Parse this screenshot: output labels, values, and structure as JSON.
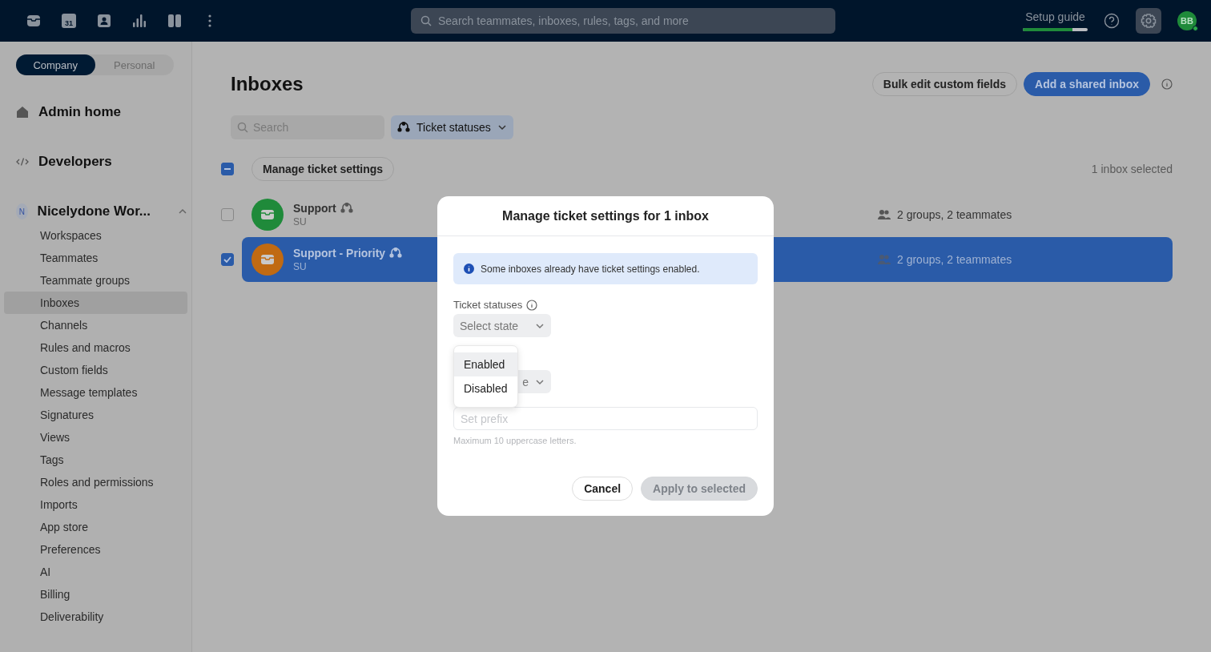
{
  "topbar": {
    "nav_icons": [
      {
        "kind": "inbox"
      },
      {
        "kind": "calendar",
        "text": "31"
      },
      {
        "kind": "contact"
      },
      {
        "kind": "analytics"
      },
      {
        "kind": "panels"
      },
      {
        "kind": "more"
      }
    ],
    "search": {
      "placeholder": "Search teammates, inboxes, rules, tags, and more"
    },
    "setup_guide": {
      "label": "Setup guide",
      "level": 0.77
    },
    "settings_active": true,
    "avatar": {
      "initials": "BB",
      "online": true
    }
  },
  "sidebar": {
    "scope_tabs": [
      {
        "label": "Company",
        "selected": true
      },
      {
        "label": "Personal",
        "selected": false
      }
    ],
    "sections": [
      {
        "kind": "home",
        "label": "Admin home"
      },
      {
        "kind": "code",
        "label": "Developers"
      }
    ],
    "workspace": {
      "badge": "N",
      "label": "Nicelydone Wor...",
      "expanded": true,
      "items": [
        {
          "label": "Workspaces",
          "selected": false
        },
        {
          "label": "Teammates",
          "selected": false
        },
        {
          "label": "Teammate groups",
          "selected": false
        },
        {
          "label": "Inboxes",
          "selected": true
        },
        {
          "label": "Channels",
          "selected": false
        },
        {
          "label": "Rules and macros",
          "selected": false
        },
        {
          "label": "Custom fields",
          "selected": false
        },
        {
          "label": "Message templates",
          "selected": false
        },
        {
          "label": "Signatures",
          "selected": false
        },
        {
          "label": "Views",
          "selected": false
        },
        {
          "label": "Tags",
          "selected": false
        },
        {
          "label": "Roles and permissions",
          "selected": false
        },
        {
          "label": "Imports",
          "selected": false
        },
        {
          "label": "App store",
          "selected": false
        },
        {
          "label": "Preferences",
          "selected": false
        },
        {
          "label": "AI",
          "selected": false
        },
        {
          "label": "Billing",
          "selected": false
        },
        {
          "label": "Deliverability",
          "selected": false
        }
      ]
    }
  },
  "main": {
    "title": "Inboxes",
    "actions": [
      {
        "label": "Bulk edit custom fields",
        "primary": false
      },
      {
        "label": "Add a shared inbox",
        "primary": true
      }
    ],
    "search": {
      "placeholder": "Search"
    },
    "filter": {
      "label": "Ticket statuses"
    },
    "bulk": {
      "indeterminate": true,
      "button": "Manage ticket settings",
      "count": "1 inbox selected"
    },
    "rows": [
      {
        "name": "Support",
        "code": "SU",
        "color": "#1f8a3a",
        "selected": false,
        "members": "2 groups, 2 teammates"
      },
      {
        "name": "Support - Priority",
        "code": "SU",
        "color": "#c06a12",
        "selected": true,
        "members": "2 groups, 2 teammates"
      }
    ]
  },
  "dialog": {
    "title": "Manage ticket settings for 1 inbox",
    "notice": "Some inboxes already have ticket settings enabled.",
    "status_label": "Ticket statuses",
    "status_select": "Select state",
    "menu": [
      {
        "label": "Enabled",
        "highlighted": true
      },
      {
        "label": "Disabled",
        "highlighted": false
      }
    ],
    "second_select": "e",
    "prefix": {
      "placeholder": "Set prefix",
      "hint": "Maximum 10 uppercase letters."
    },
    "buttons": [
      {
        "label": "Cancel",
        "primary": false,
        "disabled": false
      },
      {
        "label": "Apply to selected",
        "primary": true,
        "disabled": true
      }
    ]
  }
}
